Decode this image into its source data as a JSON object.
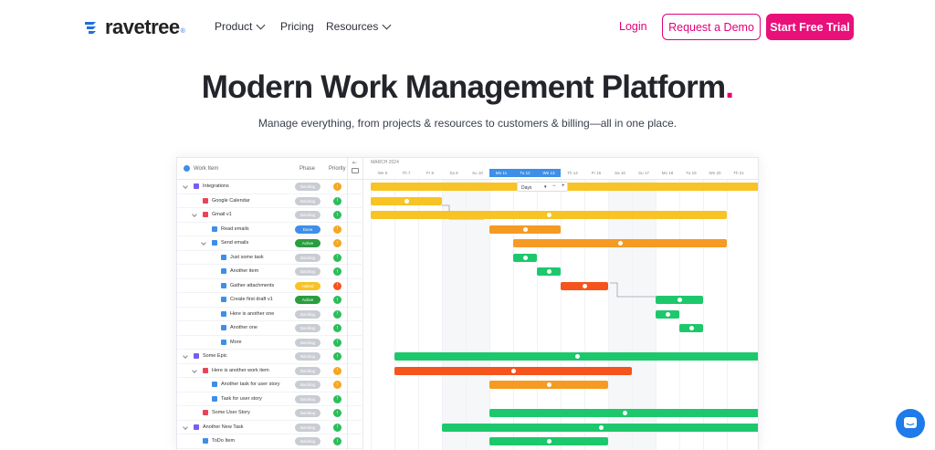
{
  "nav": {
    "brand": "ravetree",
    "brand_sup": "®",
    "links": [
      "Product",
      "Pricing",
      "Resources"
    ],
    "login": "Login",
    "demo": "Request a Demo",
    "trial": "Start Free Trial"
  },
  "hero": {
    "title": "Modern Work Management Platform",
    "title_dot": ".",
    "subtitle": "Manage everything, from projects & resources to customers & billing—all in one place."
  },
  "gantt": {
    "headers": {
      "work_item": "Work Item",
      "phase": "Phase",
      "priority": "Priority"
    },
    "month": "MARCH 2024",
    "zoom": "Days",
    "days": [
      "We 6",
      "Th 7",
      "Fr 8",
      "Sa 9",
      "Su 10",
      "Mo 11",
      "Tu 12",
      "We 13",
      "Th 14",
      "Fr 15",
      "Sa 16",
      "Su 17",
      "Mo 18",
      "Tu 19",
      "We 20",
      "Th 21"
    ],
    "rows": [
      {
        "label": "Integrations",
        "phase": "Backlog",
        "level": 0
      },
      {
        "label": "Google Calendar",
        "phase": "Backlog",
        "level": 1
      },
      {
        "label": "Gmail v1",
        "phase": "Backlog",
        "level": 1
      },
      {
        "label": "Read emails",
        "phase": "Done",
        "level": 2
      },
      {
        "label": "Send emails",
        "phase": "Active",
        "level": 2
      },
      {
        "label": "Just some task",
        "phase": "Backlog",
        "level": 3
      },
      {
        "label": "Another item",
        "phase": "Backlog",
        "level": 3
      },
      {
        "label": "Gather attachments",
        "phase": "Halted",
        "level": 3
      },
      {
        "label": "Create first draft v1",
        "phase": "Active",
        "level": 3
      },
      {
        "label": "Here is another one",
        "phase": "Backlog",
        "level": 3
      },
      {
        "label": "Another one",
        "phase": "Backlog",
        "level": 3
      },
      {
        "label": "More",
        "phase": "Backlog",
        "level": 3
      },
      {
        "label": "Some Epic",
        "phase": "Backlog",
        "level": 0
      },
      {
        "label": "Here is another work item",
        "phase": "Backlog",
        "level": 1
      },
      {
        "label": "Another task for user story",
        "phase": "Backlog",
        "level": 2
      },
      {
        "label": "Task for user story",
        "phase": "Backlog",
        "level": 2
      },
      {
        "label": "Some User Story",
        "phase": "Backlog",
        "level": 1
      },
      {
        "label": "Another New Task",
        "phase": "Backlog",
        "level": 0
      },
      {
        "label": "ToDo Item",
        "phase": "Backlog",
        "level": 1
      }
    ],
    "colors": {
      "yellow": "#f7c325",
      "orange": "#f59a23",
      "red": "#f5541c",
      "green": "#1dc86c",
      "grey": "#c9ccd3",
      "blue": "#3d8fe8",
      "pink": "#e3007a"
    }
  }
}
